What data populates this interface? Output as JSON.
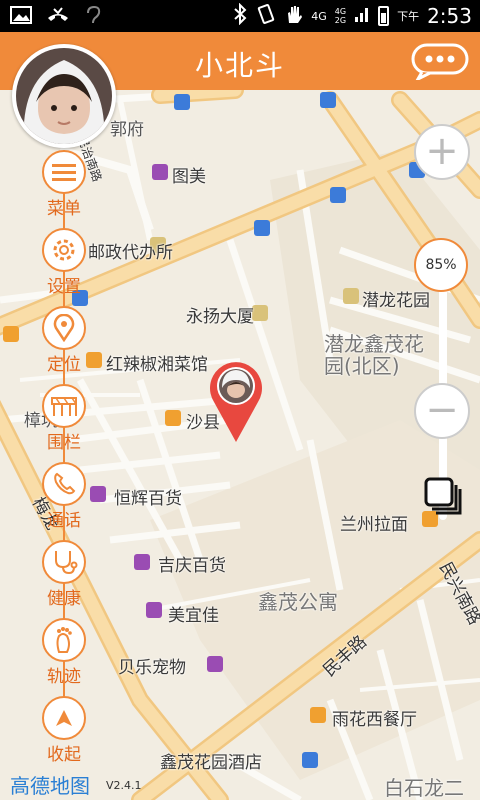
{
  "status_bar": {
    "time": "2:53",
    "ampm": "下午",
    "network": "4G",
    "network2": "4G",
    "network3": "2G"
  },
  "header": {
    "title": "小北斗"
  },
  "menu": [
    {
      "label": "菜单",
      "icon": "menu-icon"
    },
    {
      "label": "设置",
      "icon": "gear-icon"
    },
    {
      "label": "定位",
      "icon": "location-pin-icon"
    },
    {
      "label": "围栏",
      "icon": "fence-icon"
    },
    {
      "label": "通话",
      "icon": "phone-icon"
    },
    {
      "label": "健康",
      "icon": "stethoscope-icon"
    },
    {
      "label": "轨迹",
      "icon": "footprint-icon"
    },
    {
      "label": "收起",
      "icon": "collapse-icon"
    }
  ],
  "zoom": {
    "level": "85%",
    "plus": "+",
    "minus": "−"
  },
  "map": {
    "labels": [
      {
        "text": "郭府"
      },
      {
        "text": "图美"
      },
      {
        "text": "邮政代办所"
      },
      {
        "text": "潜龙花园"
      },
      {
        "text": "永扬大厦"
      },
      {
        "text": "潜龙鑫茂花"
      },
      {
        "text": "园(北区)"
      },
      {
        "text": "红辣椒湘菜馆"
      },
      {
        "text": "樟坑"
      },
      {
        "text": "沙县"
      },
      {
        "text": "恒辉百货"
      },
      {
        "text": "兰州拉面"
      },
      {
        "text": "吉庆百货"
      },
      {
        "text": "鑫茂公寓"
      },
      {
        "text": "美宜佳"
      },
      {
        "text": "贝乐宠物"
      },
      {
        "text": "雨花西餐厅"
      },
      {
        "text": "鑫茂花园酒店"
      },
      {
        "text": "白石龙二"
      },
      {
        "text": "梅龙"
      },
      {
        "text": "民丰路"
      },
      {
        "text": "民兴南路"
      },
      {
        "text": "民治南路"
      }
    ]
  },
  "footer": {
    "logo": "高德地图",
    "version": "V2.4.1"
  },
  "colors": {
    "accent": "#f08a3a",
    "accent_dark": "#e2691d",
    "map_bg": "#f2ede2",
    "road": "#f9d79a",
    "pin": "#e8483f"
  }
}
